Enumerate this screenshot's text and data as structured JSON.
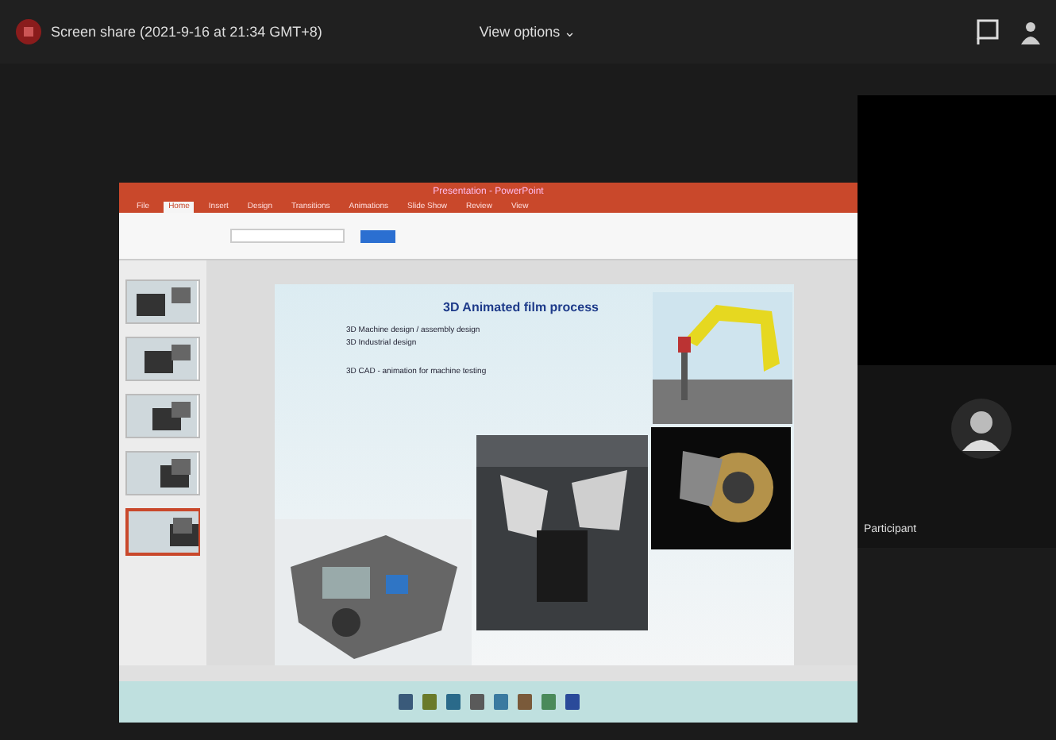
{
  "top_bar": {
    "meeting_title": "Screen share (2021-9-16 at 21:34 GMT+8)",
    "view_menu": "View options ⌄"
  },
  "shared_screen": {
    "window_title": "Presentation - PowerPoint",
    "ribbon_tabs": [
      {
        "label": "File",
        "selected": false
      },
      {
        "label": "Home",
        "selected": true
      },
      {
        "label": "Insert",
        "selected": false
      },
      {
        "label": "Design",
        "selected": false
      },
      {
        "label": "Transitions",
        "selected": false
      },
      {
        "label": "Animations",
        "selected": false
      },
      {
        "label": "Slide Show",
        "selected": false
      },
      {
        "label": "Review",
        "selected": false
      },
      {
        "label": "View",
        "selected": false
      }
    ],
    "thumbnails": [
      {
        "selected": false
      },
      {
        "selected": false
      },
      {
        "selected": false
      },
      {
        "selected": false
      },
      {
        "selected": true
      }
    ],
    "slide": {
      "title": "3D Animated film process",
      "bullets": [
        "3D Machine design / assembly design",
        "3D Industrial design",
        "3D CAD - animation for machine testing"
      ]
    }
  },
  "participant": {
    "name": "Participant"
  }
}
